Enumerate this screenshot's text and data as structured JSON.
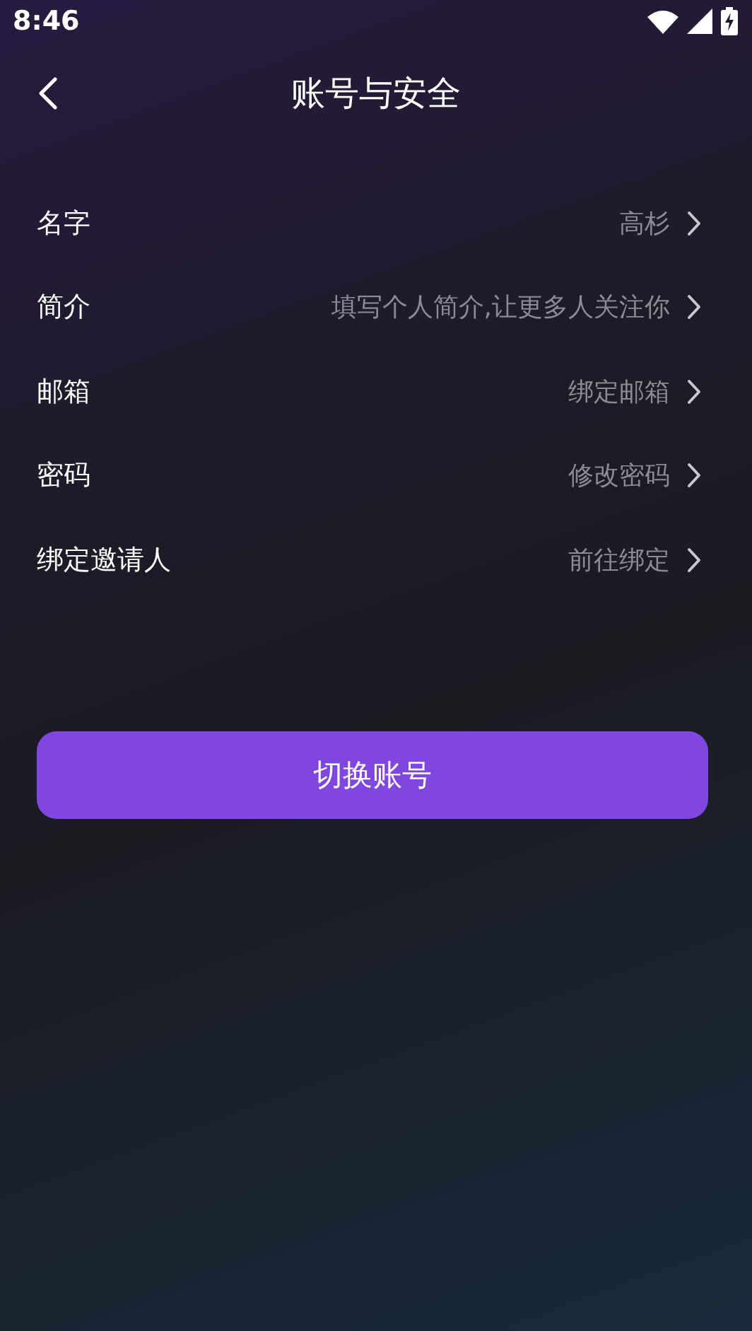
{
  "status_bar": {
    "time": "8:46"
  },
  "header": {
    "title": "账号与安全"
  },
  "rows": [
    {
      "label": "名字",
      "value": "高杉"
    },
    {
      "label": "简介",
      "value": "填写个人简介,让更多人关注你"
    },
    {
      "label": "邮箱",
      "value": "绑定邮箱"
    },
    {
      "label": "密码",
      "value": "修改密码"
    },
    {
      "label": "绑定邀请人",
      "value": "前往绑定"
    }
  ],
  "button": {
    "label": "切换账号"
  }
}
